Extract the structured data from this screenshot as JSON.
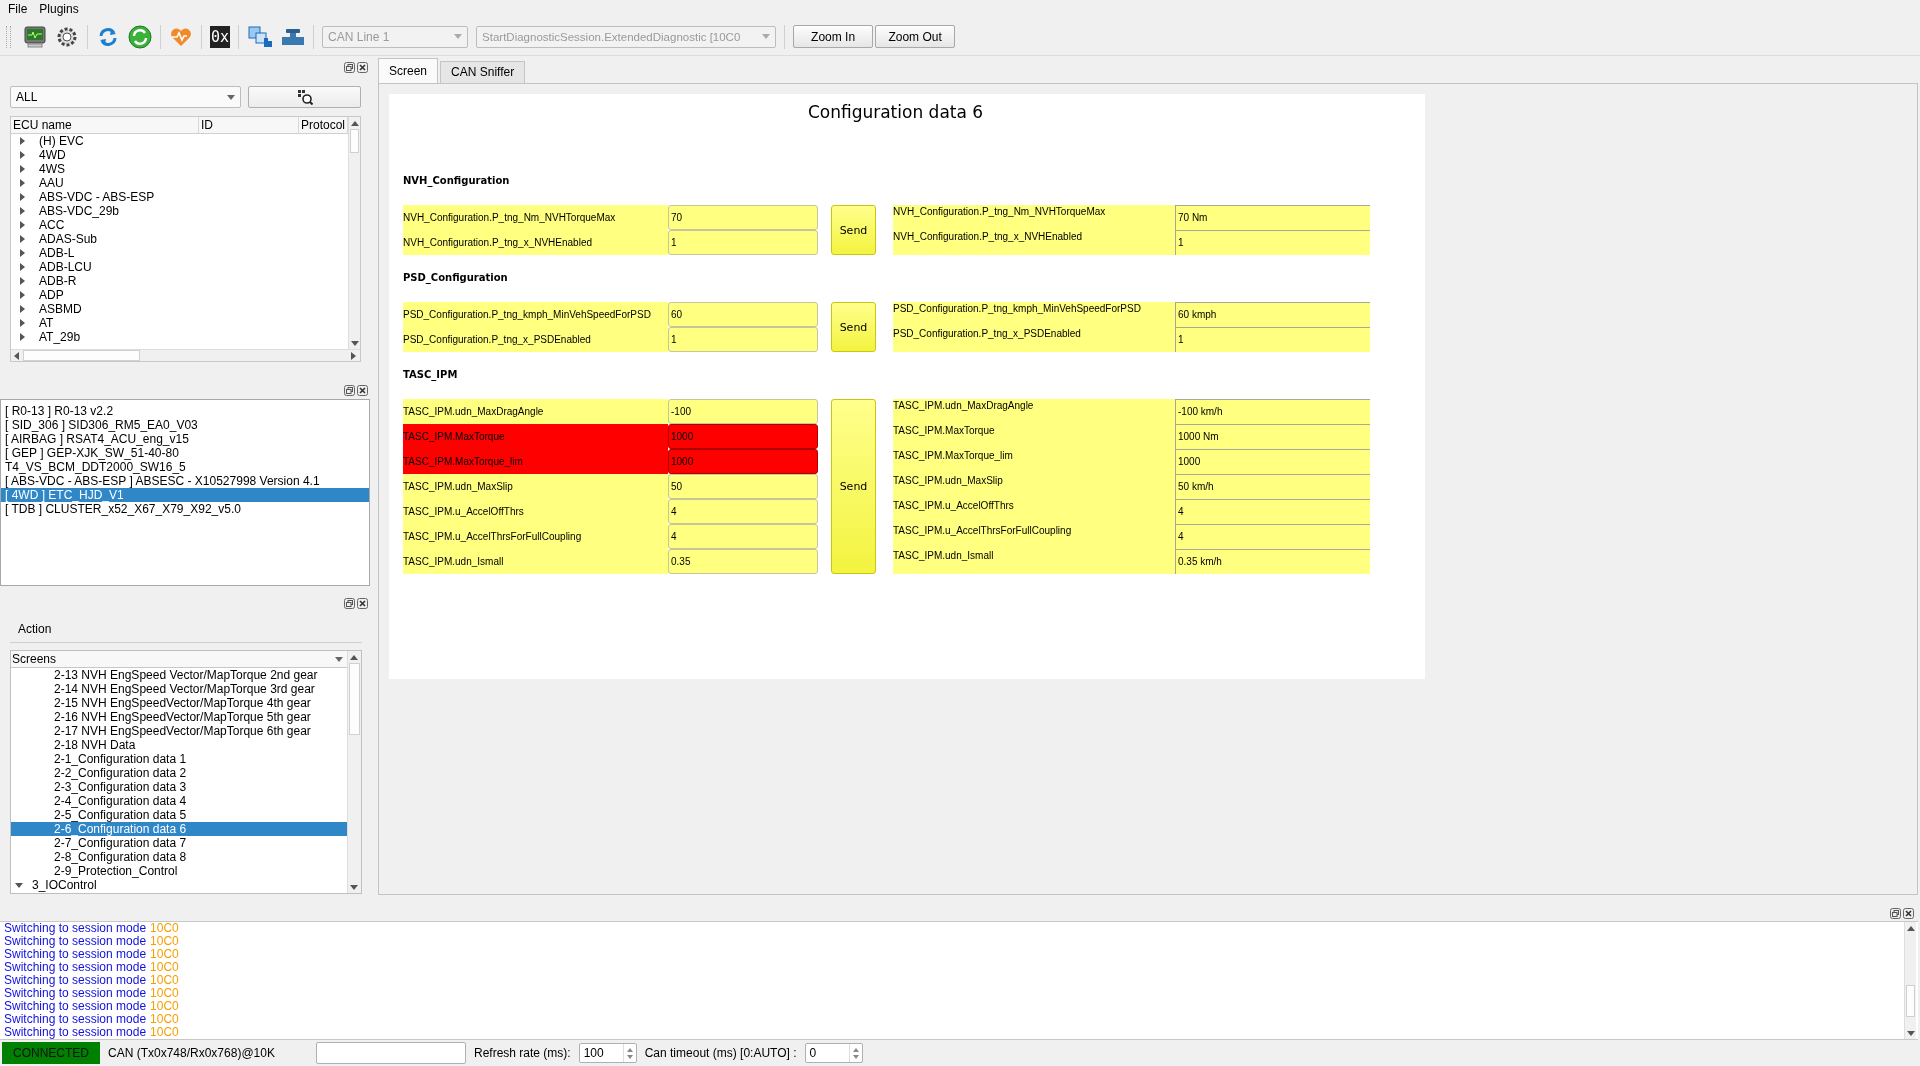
{
  "menu": [
    "File",
    "Plugins"
  ],
  "toolbar": {
    "hex_label": "0x",
    "combos": [
      {
        "value": "CAN Line 1",
        "disabled": true
      },
      {
        "value": "StartDiagnosticSession.ExtendedDiagnostic [10C0",
        "disabled": true
      }
    ],
    "buttons": [
      "Zoom In",
      "Zoom Out"
    ]
  },
  "ecu_panel": {
    "filter": "ALL",
    "columns": [
      "ECU name",
      "ID",
      "Protocol"
    ],
    "items": [
      {
        "label": "(H) EVC",
        "expanded": false
      },
      {
        "label": "4WD",
        "expanded": false
      },
      {
        "label": "4WS",
        "expanded": false
      },
      {
        "label": "AAU",
        "expanded": false
      },
      {
        "label": "ABS-VDC - ABS-ESP",
        "expanded": false
      },
      {
        "label": "ABS-VDC_29b",
        "expanded": false
      },
      {
        "label": "ACC",
        "expanded": false
      },
      {
        "label": "ADAS-Sub",
        "expanded": false
      },
      {
        "label": "ADB-L",
        "expanded": false
      },
      {
        "label": "ADB-LCU",
        "expanded": false
      },
      {
        "label": "ADB-R",
        "expanded": false
      },
      {
        "label": "ADP",
        "expanded": false
      },
      {
        "label": "ASBMD",
        "expanded": false
      },
      {
        "label": "AT",
        "expanded": false
      },
      {
        "label": "AT_29b",
        "expanded": false
      }
    ]
  },
  "ecu_list": {
    "items": [
      {
        "label": "[ R0-13 ] R0-13 v2.2",
        "selected": false
      },
      {
        "label": "[ SID_306 ] SID306_RM5_EA0_V03",
        "selected": false
      },
      {
        "label": "[ AIRBAG ] RSAT4_ACU_eng_v15",
        "selected": false
      },
      {
        "label": "[ GEP ] GEP-XJK_SW_51-40-80",
        "selected": false
      },
      {
        "label": "T4_VS_BCM_DDT2000_SW16_5",
        "selected": false
      },
      {
        "label": "[ ABS-VDC - ABS-ESP ] ABSESC - X10527998 Version 4.1",
        "selected": false
      },
      {
        "label": "[ 4WD ] ETC_HJD_V1",
        "selected": true
      },
      {
        "label": "[ TDB ] CLUSTER_x52_X67_X79_X92_v5.0",
        "selected": false
      }
    ]
  },
  "action_panel": {
    "title": "Action",
    "view": "Screens",
    "items": [
      {
        "label": "2-13 NVH EngSpeed Vector/MapTorque 2nd gear",
        "selected": false
      },
      {
        "label": "2-14 NVH EngSpeed Vector/MapTorque 3rd gear",
        "selected": false
      },
      {
        "label": "2-15 NVH EngSpeedVector/MapTorque 4th gear",
        "selected": false
      },
      {
        "label": "2-16 NVH EngSpeedVector/MapTorque 5th gear",
        "selected": false
      },
      {
        "label": "2-17 NVH EngSpeedVector/MapTorque 6th gear",
        "selected": false
      },
      {
        "label": "2-18 NVH Data",
        "selected": false
      },
      {
        "label": "2-1_Configuration data 1",
        "selected": false
      },
      {
        "label": "2-2_Configuration data 2",
        "selected": false
      },
      {
        "label": "2-3_Configuration data 3",
        "selected": false
      },
      {
        "label": "2-4_Configuration data 4",
        "selected": false
      },
      {
        "label": "2-5_Configuration data 5",
        "selected": false
      },
      {
        "label": "2-6_Configuration data 6",
        "selected": true
      },
      {
        "label": "2-7_Configuration data 7",
        "selected": false
      },
      {
        "label": "2-8_Configuration data 8",
        "selected": false
      },
      {
        "label": "2-9_Protection_Control",
        "selected": false
      }
    ],
    "next_group": {
      "label": "3_IOControl",
      "expanded": true
    }
  },
  "tabs": [
    {
      "label": "Screen",
      "selected": true
    },
    {
      "label": "CAN Sniffer",
      "selected": false
    }
  ],
  "screen": {
    "title": "Configuration data 6",
    "sections": [
      {
        "title": "NVH_Configuration",
        "send": "Send",
        "params": [
          {
            "label": "NVH_Configuration.P_tng_Nm_NVHTorqueMax",
            "value": "70",
            "error": false,
            "readback_label": "NVH_Configuration.P_tng_Nm_NVHTorqueMax",
            "readback_value": "70 Nm"
          },
          {
            "label": "NVH_Configuration.P_tng_x_NVHEnabled",
            "value": "1",
            "error": false,
            "readback_label": "NVH_Configuration.P_tng_x_NVHEnabled",
            "readback_value": "1"
          }
        ]
      },
      {
        "title": "PSD_Configuration",
        "send": "Send",
        "params": [
          {
            "label": "PSD_Configuration.P_tng_kmph_MinVehSpeedForPSD",
            "value": "60",
            "error": false,
            "readback_label": "PSD_Configuration.P_tng_kmph_MinVehSpeedForPSD",
            "readback_value": "60 kmph"
          },
          {
            "label": "PSD_Configuration.P_tng_x_PSDEnabled",
            "value": "1",
            "error": false,
            "readback_label": "PSD_Configuration.P_tng_x_PSDEnabled",
            "readback_value": "1"
          }
        ]
      },
      {
        "title": "TASC_IPM",
        "send": "Send",
        "params": [
          {
            "label": "TASC_IPM.udn_MaxDragAngle",
            "value": "-100",
            "error": false,
            "readback_label": "TASC_IPM.udn_MaxDragAngle",
            "readback_value": "-100 km/h"
          },
          {
            "label": "TASC_IPM.MaxTorque",
            "value": "1000",
            "error": true,
            "readback_label": "TASC_IPM.MaxTorque",
            "readback_value": "1000 Nm"
          },
          {
            "label": "TASC_IPM.MaxTorque_lim",
            "value": "1000",
            "error": true,
            "readback_label": "TASC_IPM.MaxTorque_lim",
            "readback_value": "1000"
          },
          {
            "label": "TASC_IPM.udn_MaxSlip",
            "value": "50",
            "error": false,
            "readback_label": "TASC_IPM.udn_MaxSlip",
            "readback_value": "50 km/h"
          },
          {
            "label": "TASC_IPM.u_AccelOffThrs",
            "value": "4",
            "error": false,
            "readback_label": "TASC_IPM.u_AccelOffThrs",
            "readback_value": "4"
          },
          {
            "label": "TASC_IPM.u_AccelThrsForFullCoupling",
            "value": "4",
            "error": false,
            "readback_label": "TASC_IPM.u_AccelThrsForFullCoupling",
            "readback_value": "4"
          },
          {
            "label": "TASC_IPM.udn_Ismall",
            "value": "0.35",
            "error": false,
            "readback_label": "TASC_IPM.udn_Ismall",
            "readback_value": "0.35 km/h"
          }
        ]
      }
    ]
  },
  "log": [
    {
      "message": "Switching to session mode",
      "code": "10C0"
    },
    {
      "message": "Switching to session mode",
      "code": "10C0"
    },
    {
      "message": "Switching to session mode",
      "code": "10C0"
    },
    {
      "message": "Switching to session mode",
      "code": "10C0"
    },
    {
      "message": "Switching to session mode",
      "code": "10C0"
    },
    {
      "message": "Switching to session mode",
      "code": "10C0"
    },
    {
      "message": "Switching to session mode",
      "code": "10C0"
    },
    {
      "message": "Switching to session mode",
      "code": "10C0"
    },
    {
      "message": "Switching to session mode",
      "code": "10C0"
    }
  ],
  "status_bar": {
    "connection": "CONNECTED",
    "connected": true,
    "link": "CAN (Tx0x748/Rx0x768)@10K",
    "refresh_label": "Refresh rate (ms):",
    "refresh_value": "100",
    "timeout_label": "Can timeout (ms) [0:AUTO] :",
    "timeout_value": "0"
  }
}
